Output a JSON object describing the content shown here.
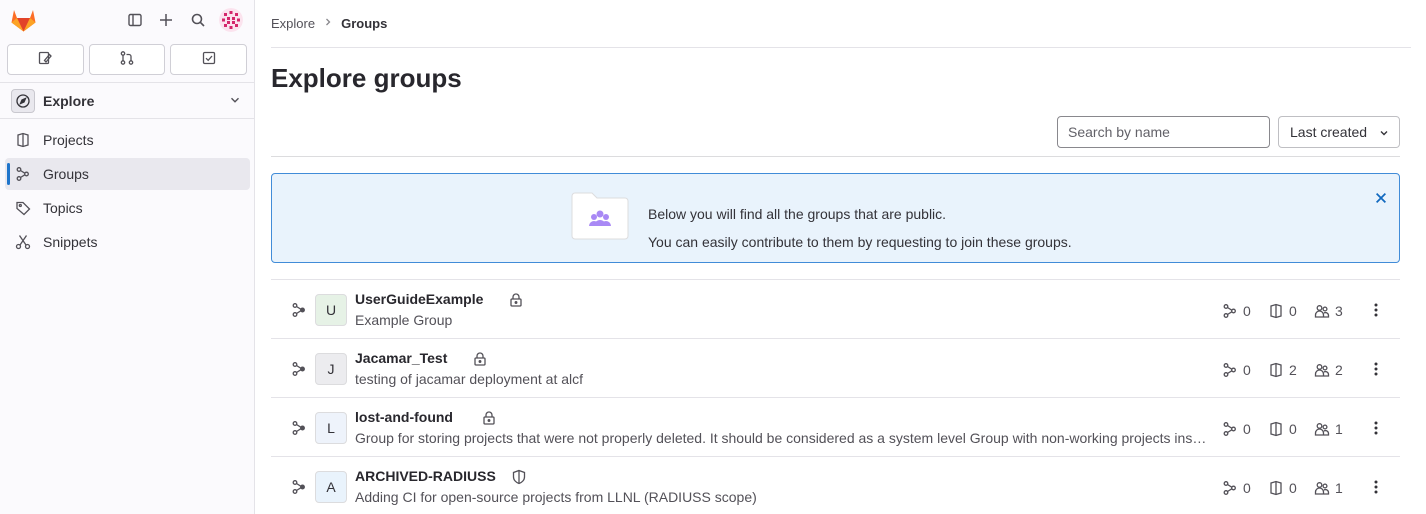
{
  "sidebar": {
    "context": {
      "label": "Explore",
      "icon": "compass-icon"
    },
    "tabs": [
      {
        "name": "issues",
        "icon": "issues-icon"
      },
      {
        "name": "merge-requests",
        "icon": "merge-request-icon"
      },
      {
        "name": "todos",
        "icon": "todo-icon"
      }
    ],
    "items": [
      {
        "label": "Projects",
        "icon": "project-icon",
        "active": false
      },
      {
        "label": "Groups",
        "icon": "group-icon",
        "active": true
      },
      {
        "label": "Topics",
        "icon": "label-icon",
        "active": false
      },
      {
        "label": "Snippets",
        "icon": "snippet-icon",
        "active": false
      }
    ]
  },
  "breadcrumb": {
    "parent": "Explore",
    "current": "Groups"
  },
  "page": {
    "title": "Explore groups"
  },
  "filters": {
    "search_placeholder": "Search by name",
    "sort_label": "Last created"
  },
  "alert": {
    "line1": "Below you will find all the groups that are public.",
    "line2": "You can easily contribute to them by requesting to join these groups."
  },
  "groups": [
    {
      "initial": "U",
      "name": "UserGuideExample",
      "visibility": "private",
      "description": "Example Group",
      "subgroups": "0",
      "projects": "0",
      "members": "3",
      "avatar_bg": "#e6f2e6"
    },
    {
      "initial": "J",
      "name": "Jacamar_Test",
      "visibility": "private",
      "description": "testing of jacamar deployment at alcf",
      "subgroups": "0",
      "projects": "2",
      "members": "2",
      "avatar_bg": "#ececef"
    },
    {
      "initial": "L",
      "name": "lost-and-found",
      "visibility": "private",
      "description": "Group for storing projects that were not properly deleted. It should be considered as a system level Group with non-working projects inside it. The contents may be deleted at a future date.",
      "subgroups": "0",
      "projects": "0",
      "members": "1",
      "avatar_bg": "#eef3fb"
    },
    {
      "initial": "A",
      "name": "ARCHIVED-RADIUSS",
      "visibility": "internal",
      "description": "Adding CI for open-source projects from LLNL (RADIUSS scope)",
      "subgroups": "0",
      "projects": "0",
      "members": "1",
      "avatar_bg": "#e9f3fc"
    }
  ],
  "colors": {
    "accent": "#1f75cb",
    "alert_bg": "#e9f3fc",
    "alert_border": "#418cd8",
    "illustration": "#a989f5"
  }
}
